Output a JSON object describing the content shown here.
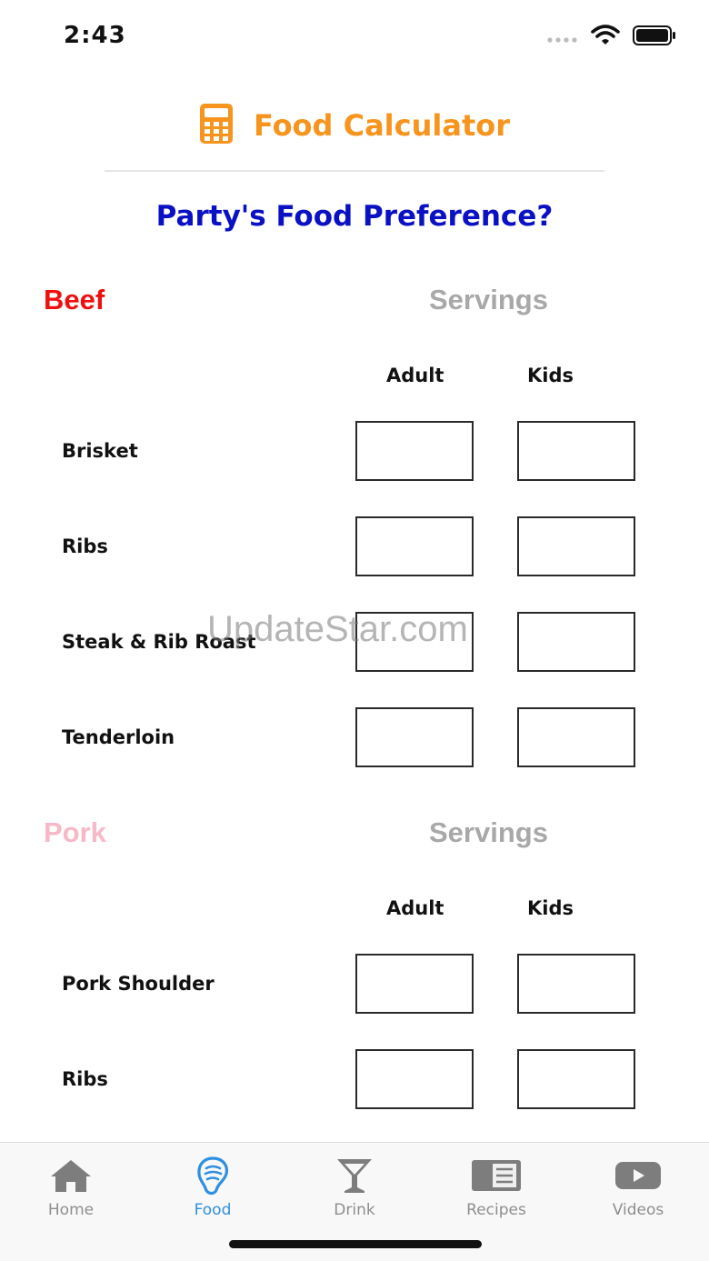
{
  "status": {
    "time": "2:43"
  },
  "header": {
    "title": "Food Calculator",
    "icon": "calculator-icon",
    "accent": "#f7941d"
  },
  "question": "Party's Food Preference?",
  "sections": [
    {
      "title": "Beef",
      "title_color": "#f00f0f",
      "servings_label": "Servings",
      "columns": [
        "Adult",
        "Kids"
      ],
      "rows": [
        {
          "label": "Brisket",
          "adult": "",
          "kids": ""
        },
        {
          "label": "Ribs",
          "adult": "",
          "kids": ""
        },
        {
          "label": "Steak & Rib Roast",
          "adult": "",
          "kids": ""
        },
        {
          "label": "Tenderloin",
          "adult": "",
          "kids": ""
        }
      ]
    },
    {
      "title": "Pork",
      "title_color": "#f7b8c8",
      "servings_label": "Servings",
      "columns": [
        "Adult",
        "Kids"
      ],
      "rows": [
        {
          "label": "Pork Shoulder",
          "adult": "",
          "kids": ""
        },
        {
          "label": "Ribs",
          "adult": "",
          "kids": ""
        }
      ]
    }
  ],
  "watermark": "UpdateStar.com",
  "tabs": [
    {
      "label": "Home",
      "icon": "home-icon",
      "active": false
    },
    {
      "label": "Food",
      "icon": "food-icon",
      "active": true
    },
    {
      "label": "Drink",
      "icon": "cocktail-icon",
      "active": false
    },
    {
      "label": "Recipes",
      "icon": "recipe-book-icon",
      "active": false
    },
    {
      "label": "Videos",
      "icon": "video-play-icon",
      "active": false
    }
  ],
  "colors": {
    "active_tab": "#2f8fe0",
    "inactive_tab": "#8e8e8e",
    "question": "#0a10c4"
  }
}
